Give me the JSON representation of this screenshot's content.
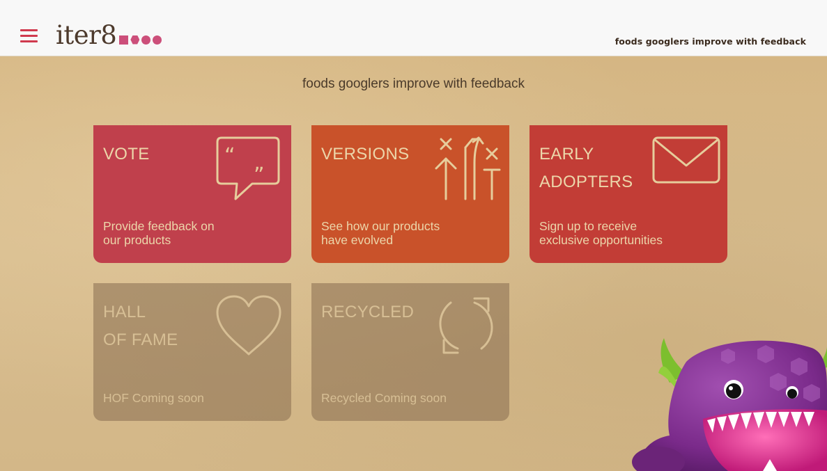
{
  "header": {
    "logo_text": "iter8",
    "tagline": "foods googlers improve with feedback"
  },
  "main": {
    "title": "foods googlers improve with feedback",
    "tiles": [
      {
        "title_lines": [
          "VOTE"
        ],
        "description_lines": [
          "Provide feedback on",
          "our products"
        ],
        "icon": "speech-bubble-quote-icon",
        "color": "#c0404c"
      },
      {
        "title_lines": [
          "VERSIONS"
        ],
        "description_lines": [
          "See how our products",
          "have evolved"
        ],
        "icon": "arrows-versions-icon",
        "color": "#c9522a"
      },
      {
        "title_lines": [
          "EARLY",
          "ADOPTERS"
        ],
        "description_lines": [
          "Sign up to receive",
          "exclusive opportunities"
        ],
        "icon": "envelope-icon",
        "color": "#c23d36"
      },
      {
        "title_lines": [
          "HALL",
          "OF FAME"
        ],
        "description_lines": [
          "HOF Coming soon"
        ],
        "icon": "heart-icon",
        "color": "#8c7052"
      },
      {
        "title_lines": [
          "RECYCLED"
        ],
        "description_lines": [
          "Recycled Coming soon"
        ],
        "icon": "recycle-arrows-icon",
        "color": "#8c7052"
      }
    ]
  },
  "colors": {
    "accent": "#d03a4e",
    "logo_marks": "#cc4f7a",
    "background": "#d3b88a"
  }
}
